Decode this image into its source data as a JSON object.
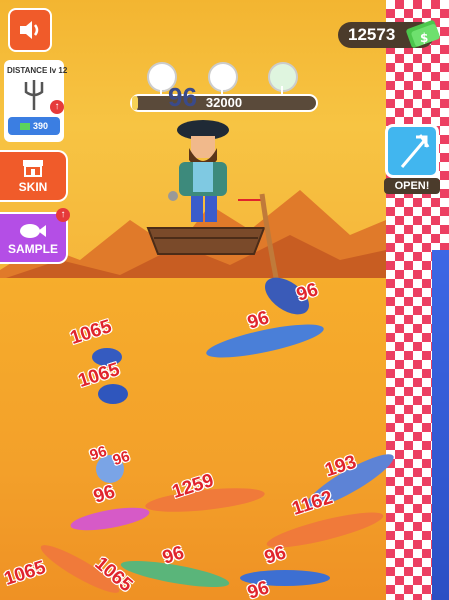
{
  "hud": {
    "money": "12573",
    "depth_current": "96",
    "depth_target": "32000",
    "progress_fraction": 0.03
  },
  "left_panel": {
    "card_title": "DISTANCE lv 12",
    "card_price": "390",
    "skin_label": "SKIN",
    "sample_label": "SAMPLE"
  },
  "right_panel": {
    "open_label": "OPEN!"
  },
  "top_markers": [
    "trident-icon",
    "boat-icon",
    "cash-icon"
  ],
  "catch_numbers": [
    "96",
    "96",
    "1065",
    "1065",
    "96",
    "96",
    "96",
    "1259",
    "193",
    "1162",
    "96",
    "96",
    "1065",
    "1065",
    "96"
  ],
  "colors": {
    "accent_orange": "#f05b2a",
    "accent_purple": "#b44ee6",
    "open_blue": "#41b6ef",
    "checker_red": "#ec3f62"
  }
}
